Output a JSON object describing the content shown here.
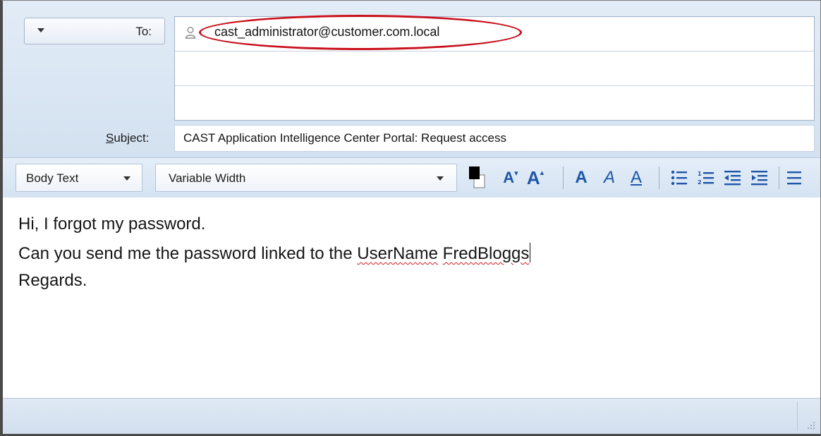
{
  "compose": {
    "to_label": "To:",
    "recipients": [
      "cast_administrator@customer.com.local",
      "",
      ""
    ],
    "subject_label_prefix": "S",
    "subject_label_rest": "ubject:",
    "subject_value": "CAST Application Intelligence Center Portal: Request access"
  },
  "toolbar": {
    "paragraph_style": "Body Text",
    "font_family": "Variable Width",
    "icons": [
      "text-color-icon",
      "decrease-font-size-icon",
      "increase-font-size-icon",
      "bold-icon",
      "italic-icon",
      "underline-icon",
      "bullet-list-icon",
      "numbered-list-icon",
      "decrease-indent-icon",
      "increase-indent-icon",
      "align-icon"
    ],
    "text_color": "#000000"
  },
  "body": {
    "line1": "Hi, I forgot my password.",
    "line2_prefix": "Can you send me the password linked to the ",
    "line2_word1": "UserName",
    "line2_space": " ",
    "line2_word2": "FredBloggs",
    "line3": "Regards."
  },
  "colors": {
    "highlight": "#c8101c",
    "spellcheck": "#d2191c",
    "toolbar_icon": "#1f56a8"
  }
}
